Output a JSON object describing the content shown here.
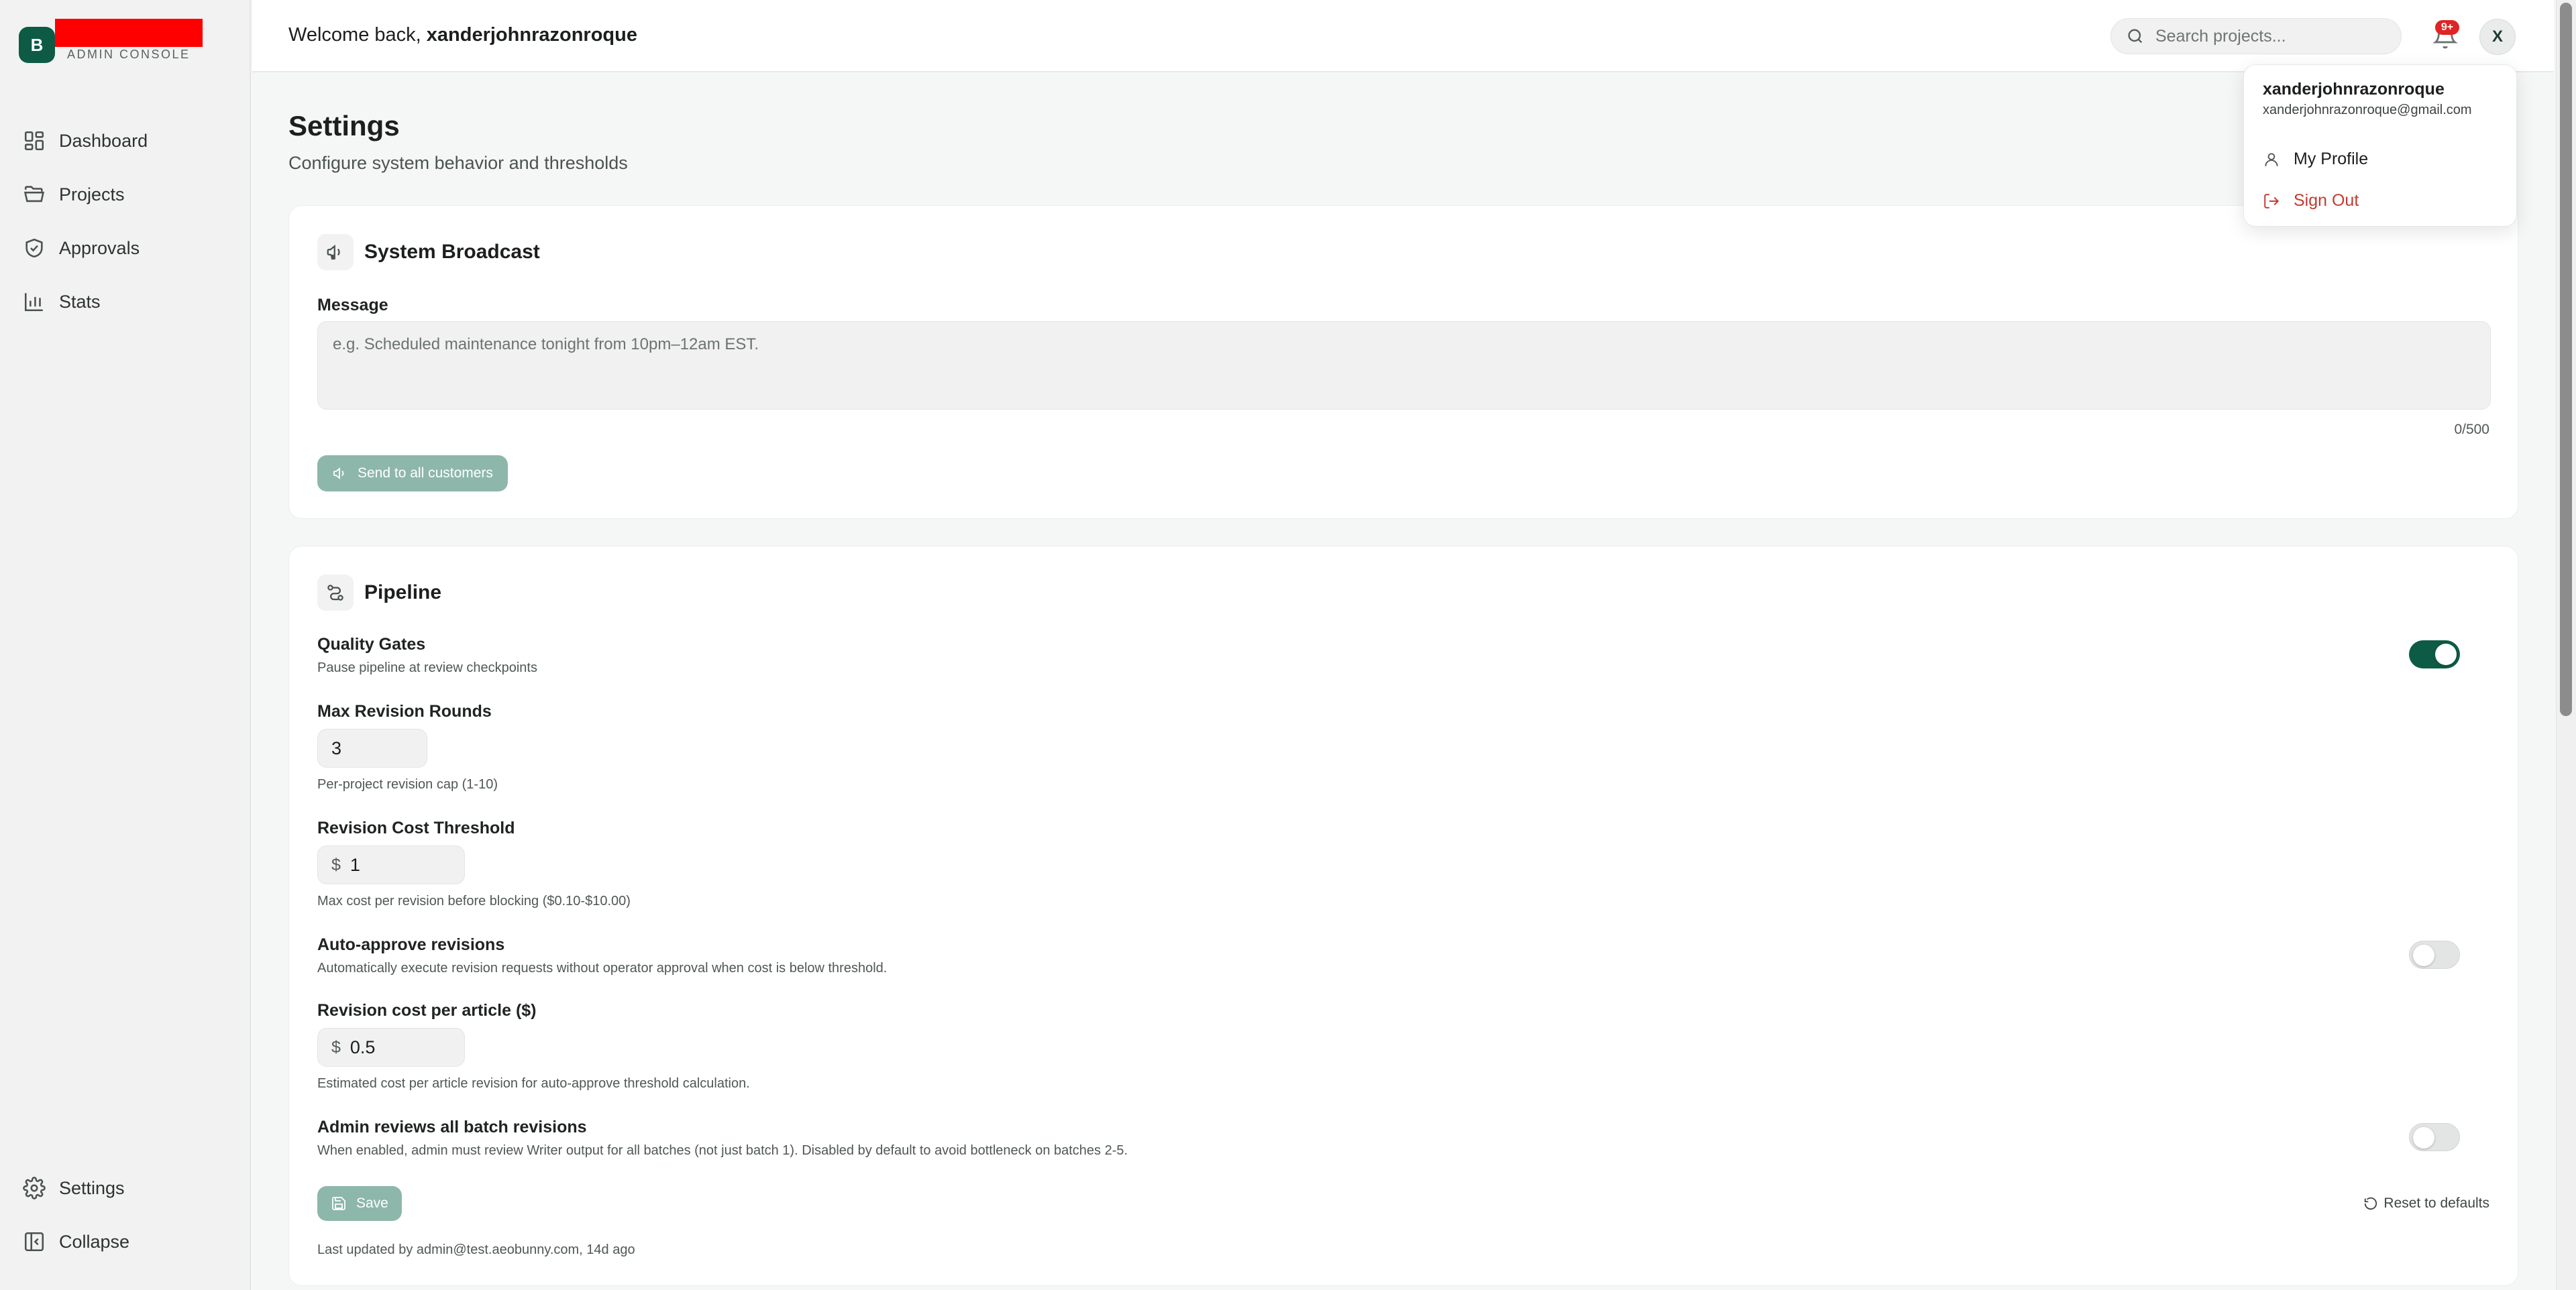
{
  "brand": {
    "logo_letter": "B",
    "subtitle": "ADMIN CONSOLE"
  },
  "sidebar": {
    "items": [
      {
        "label": "Dashboard",
        "icon": "dashboard-grid-icon"
      },
      {
        "label": "Projects",
        "icon": "folder-open-icon"
      },
      {
        "label": "Approvals",
        "icon": "shield-check-icon"
      },
      {
        "label": "Stats",
        "icon": "bar-chart-icon"
      }
    ],
    "bottom": [
      {
        "label": "Settings",
        "icon": "gear-icon"
      },
      {
        "label": "Collapse",
        "icon": "panel-collapse-icon"
      }
    ]
  },
  "header": {
    "welcome_prefix": "Welcome back, ",
    "username": "xanderjohnrazonroque",
    "search_placeholder": "Search projects...",
    "notification_badge": "9+",
    "avatar_letter": "X"
  },
  "user_menu": {
    "name": "xanderjohnrazonroque",
    "email": "xanderjohnrazonroque@gmail.com",
    "items": [
      {
        "label": "My Profile",
        "icon": "user-icon",
        "color": "#1c1f1e"
      },
      {
        "label": "Sign Out",
        "icon": "sign-out-icon",
        "color": "#c43a2f"
      }
    ]
  },
  "page": {
    "title": "Settings",
    "subtitle": "Configure system behavior and thresholds"
  },
  "broadcast": {
    "title": "System Broadcast",
    "message_label": "Message",
    "message_placeholder": "e.g. Scheduled maintenance tonight from 10pm–12am EST.",
    "message_value": "",
    "counter": "0/500",
    "send_label": "Send to all customers"
  },
  "pipeline": {
    "title": "Pipeline",
    "quality_gates": {
      "label": "Quality Gates",
      "help": "Pause pipeline at review checkpoints",
      "enabled": true
    },
    "max_revision_rounds": {
      "label": "Max Revision Rounds",
      "value": "3",
      "help": "Per-project revision cap (1-10)"
    },
    "revision_cost_threshold": {
      "label": "Revision Cost Threshold",
      "currency": "$",
      "value": "1",
      "help": "Max cost per revision before blocking ($0.10-$10.00)"
    },
    "auto_approve": {
      "label": "Auto-approve revisions",
      "help": "Automatically execute revision requests without operator approval when cost is below threshold.",
      "enabled": false
    },
    "revision_cost_per_article": {
      "label": "Revision cost per article ($)",
      "currency": "$",
      "value": "0.5",
      "help": "Estimated cost per article revision for auto-approve threshold calculation."
    },
    "admin_reviews_all": {
      "label": "Admin reviews all batch revisions",
      "help": "When enabled, admin must review Writer output for all batches (not just batch 1). Disabled by default to avoid bottleneck on batches 2-5.",
      "enabled": false
    },
    "save_label": "Save",
    "reset_label": "Reset to defaults",
    "last_updated": "Last updated by admin@test.aeobunny.com, 14d ago"
  },
  "colors": {
    "accent": "#0d5b45",
    "button_disabled": "#8db7aa",
    "danger": "#c43a2f",
    "badge": "#e02424"
  }
}
